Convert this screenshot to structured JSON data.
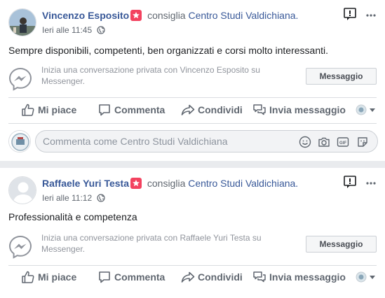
{
  "posts": [
    {
      "author": "Vincenzo Esposito",
      "recommend_text": "consiglia",
      "page": "Centro Studi Valdichiana.",
      "time": "Ieri alle 11:45",
      "text": "Sempre disponibili, competenti, ben organizzati e corsi molto interessanti.",
      "messenger_text": "Inizia una conversazione privata con Vincenzo Esposito su Messenger.",
      "message_button": "Messaggio"
    },
    {
      "author": "Raffaele Yuri Testa",
      "recommend_text": "consiglia",
      "page": "Centro Studi Valdichiana.",
      "time": "Ieri alle 11:12",
      "text": "Professionalità e competenza",
      "messenger_text": "Inizia una conversazione privata con Raffaele Yuri Testa su Messenger.",
      "message_button": "Messaggio"
    }
  ],
  "actions": {
    "like": "Mi piace",
    "comment": "Comment​a",
    "share": "Condividi",
    "send": "Invia messaggio"
  },
  "comment_input": {
    "placeholder": "Commenta come Centro Studi Valdichiana"
  },
  "colors": {
    "link": "#385898",
    "badge": "#f3425f",
    "muted": "#606770"
  }
}
